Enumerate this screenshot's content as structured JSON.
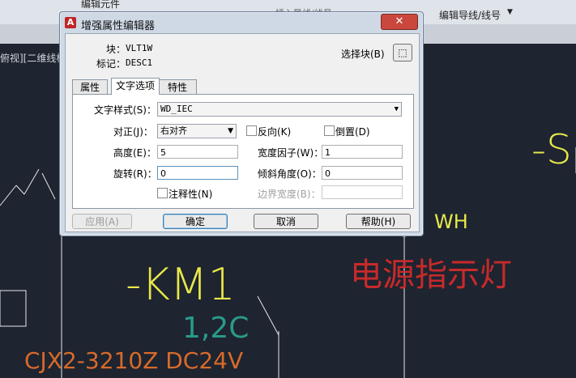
{
  "background": {
    "ribbon_text_1": "编辑元件",
    "ribbon_text_2": "插入导线/线号",
    "ribbon_text_3": "编辑导线/线号",
    "viewport_label": "俯视][二维线框",
    "cad_text": {
      "km1": "-KM1",
      "terminal": "1,2C",
      "model": "CJX2-3210Z   DC24V",
      "power_label": "电源指示灯",
      "wh": "WH",
      "s_partial": "-S"
    },
    "colors": {
      "yellow": "#e8e84a",
      "red": "#c82a2a",
      "teal": "#2a9a8a",
      "orange": "#d86a2a"
    }
  },
  "dialog": {
    "title": "增强属性编辑器",
    "close_label": "✕",
    "block_label": "块：",
    "block_value": "VLT1W",
    "tag_label": "标记：",
    "tag_value": "DESC1",
    "select_block_label": "选择块(B)",
    "tabs": [
      {
        "label": "属性"
      },
      {
        "label": "文字选项"
      },
      {
        "label": "特性"
      }
    ],
    "text_style_label": "文字样式(S)：",
    "text_style_value": "WD_IEC",
    "justify_label": "对正(J)：",
    "justify_value": "右对齐",
    "backwards_label": "反向(K)",
    "upside_down_label": "倒置(D)",
    "height_label": "高度(E)：",
    "height_value": "5",
    "width_factor_label": "宽度因子(W)：",
    "width_factor_value": "1",
    "rotation_label": "旋转(R)：",
    "rotation_value": "0",
    "oblique_label": "倾斜角度(O)：",
    "oblique_value": "0",
    "annotative_label": "注释性(N)",
    "boundary_width_label": "边界宽度(B)：",
    "boundary_width_value": "",
    "apply_label": "应用(A)",
    "ok_label": "确定",
    "cancel_label": "取消",
    "help_label": "帮助(H)"
  }
}
